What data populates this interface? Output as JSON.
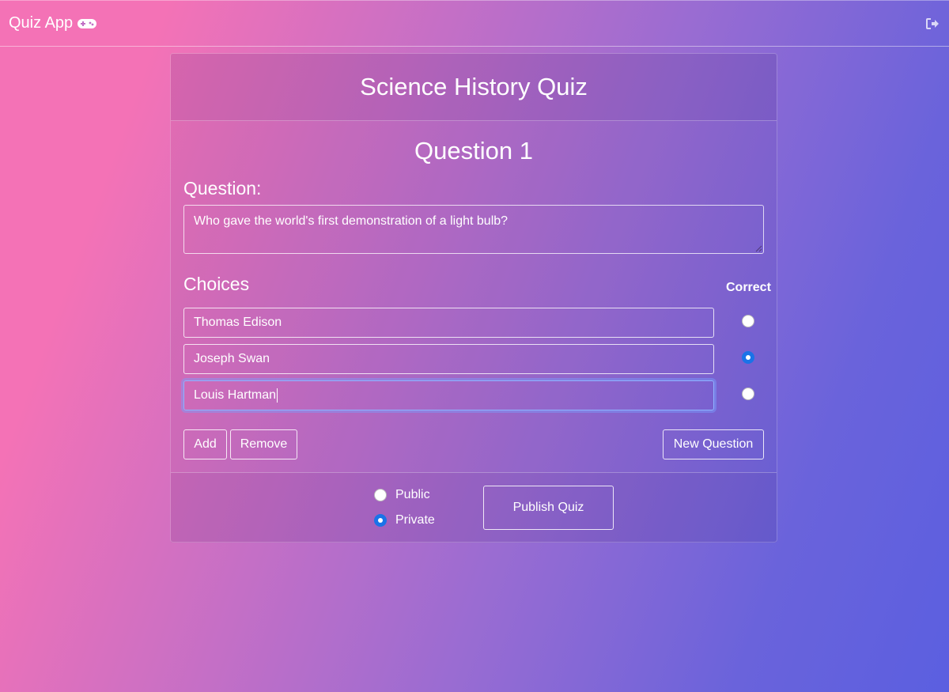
{
  "navbar": {
    "brand_text": "Quiz App",
    "brand_icon": "gamepad-icon",
    "logout_icon": "sign-out-icon"
  },
  "quiz": {
    "title": "Science History Quiz"
  },
  "question": {
    "heading": "Question 1",
    "label": "Question:",
    "text": "Who gave the world's first demonstration of a light bulb?"
  },
  "choices": {
    "label": "Choices",
    "correct_label": "Correct",
    "items": [
      {
        "text": "Thomas Edison",
        "correct": false
      },
      {
        "text": "Joseph Swan",
        "correct": true
      },
      {
        "text": "Louis Hartman",
        "correct": false,
        "focused": true
      }
    ]
  },
  "actions": {
    "add": "Add",
    "remove": "Remove",
    "new_question": "New Question"
  },
  "visibility": {
    "options": [
      "Public",
      "Private"
    ],
    "selected": "Private"
  },
  "publish": {
    "label": "Publish Quiz"
  },
  "colors": {
    "gradient_start": "#f472b6",
    "gradient_end": "#5b5fe0",
    "radio_selected": "#1a73e8"
  }
}
